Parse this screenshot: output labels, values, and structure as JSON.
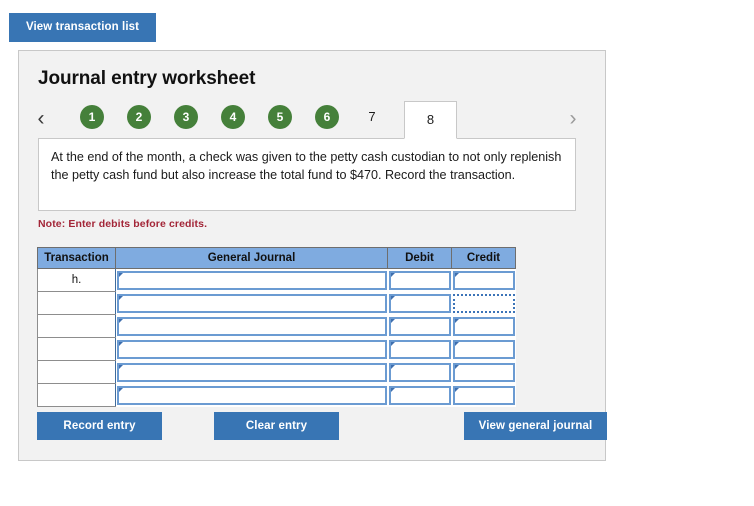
{
  "toolbar": {
    "view_transaction_list_label": "View transaction list"
  },
  "panel": {
    "title": "Journal entry worksheet",
    "nav": {
      "prev_icon": "chevron-left-icon",
      "next_icon": "chevron-right-icon",
      "prev_glyph": "‹",
      "next_glyph": "›"
    },
    "tabs": [
      {
        "label": "1",
        "state": "complete"
      },
      {
        "label": "2",
        "state": "complete"
      },
      {
        "label": "3",
        "state": "complete"
      },
      {
        "label": "4",
        "state": "complete"
      },
      {
        "label": "5",
        "state": "complete"
      },
      {
        "label": "6",
        "state": "complete"
      },
      {
        "label": "7",
        "state": "plain"
      },
      {
        "label": "8",
        "state": "active"
      }
    ],
    "instruction": "At the end of the month, a check was given to the petty cash custodian to not only replenish the petty cash fund but also increase the total fund to $470. Record the transaction.",
    "note": "Note: Enter debits before credits."
  },
  "journal": {
    "columns": [
      "Transaction",
      "General Journal",
      "Debit",
      "Credit"
    ],
    "rows": [
      {
        "transaction": "h.",
        "general_journal": "",
        "debit": "",
        "credit": "",
        "credit_selected": false
      },
      {
        "transaction": "",
        "general_journal": "",
        "debit": "",
        "credit": "",
        "credit_selected": true
      },
      {
        "transaction": "",
        "general_journal": "",
        "debit": "",
        "credit": "",
        "credit_selected": false
      },
      {
        "transaction": "",
        "general_journal": "",
        "debit": "",
        "credit": "",
        "credit_selected": false
      },
      {
        "transaction": "",
        "general_journal": "",
        "debit": "",
        "credit": "",
        "credit_selected": false
      },
      {
        "transaction": "",
        "general_journal": "",
        "debit": "",
        "credit": "",
        "credit_selected": false
      }
    ]
  },
  "actions": {
    "record_entry_label": "Record entry",
    "clear_entry_label": "Clear entry",
    "view_general_journal_label": "View general journal"
  },
  "colors": {
    "button_blue": "#3875B4",
    "table_header_blue": "#7FABE0",
    "step_green": "#45803A",
    "note_red": "#A32638",
    "panel_gray": "#F2F2F2",
    "cell_border_blue": "#6B9BD2"
  }
}
